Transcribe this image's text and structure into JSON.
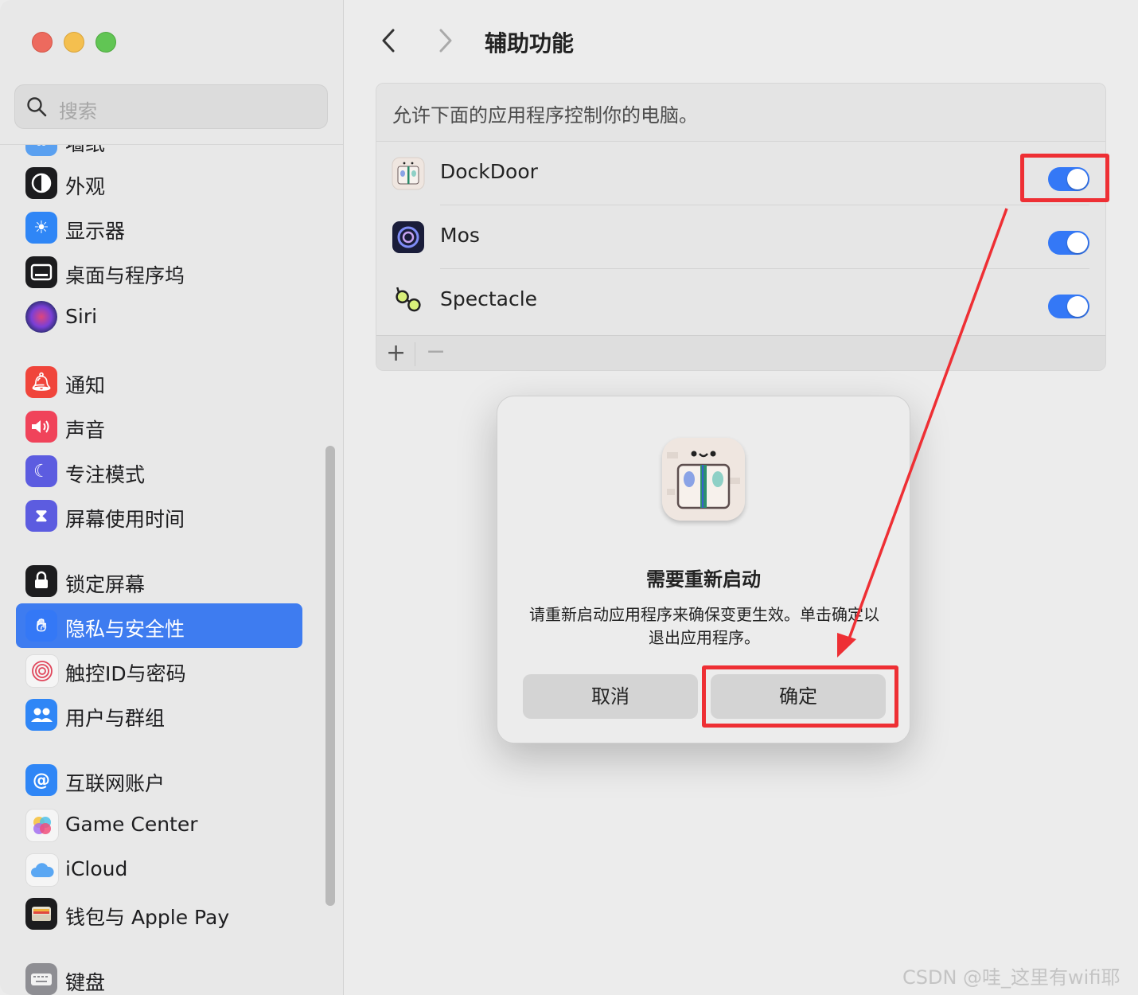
{
  "window": {
    "title": "辅助功能"
  },
  "search": {
    "placeholder": "搜索"
  },
  "sidebar": {
    "items": [
      {
        "label": "墙纸",
        "icon": "wallpaper-icon",
        "color": "#5aa0f0"
      },
      {
        "label": "外观",
        "icon": "appearance-icon",
        "color": "#1c1c1e"
      },
      {
        "label": "显示器",
        "icon": "display-icon",
        "color": "#2f86f6"
      },
      {
        "label": "桌面与程序坞",
        "icon": "dock-icon",
        "color": "#1c1c1e"
      },
      {
        "label": "Siri",
        "icon": "siri-icon",
        "color": "#3a2f6e"
      },
      {
        "label": "通知",
        "icon": "notification-bell-icon",
        "color": "#f0453b"
      },
      {
        "label": "声音",
        "icon": "speaker-icon",
        "color": "#f0435a"
      },
      {
        "label": "专注模式",
        "icon": "moon-icon",
        "color": "#5c5ce0"
      },
      {
        "label": "屏幕使用时间",
        "icon": "hourglass-icon",
        "color": "#5c5ce0"
      },
      {
        "label": "锁定屏幕",
        "icon": "lock-icon",
        "color": "#1c1c1e"
      },
      {
        "label": "隐私与安全性",
        "icon": "hand-icon",
        "color": "#3478f6"
      },
      {
        "label": "触控ID与密码",
        "icon": "fingerprint-icon",
        "color": "#f5f5f5"
      },
      {
        "label": "用户与群组",
        "icon": "users-icon",
        "color": "#2f86f6"
      },
      {
        "label": "互联网账户",
        "icon": "at-icon",
        "color": "#2f86f6"
      },
      {
        "label": "Game Center",
        "icon": "game-center-icon",
        "color": "#f5f5f5"
      },
      {
        "label": "iCloud",
        "icon": "cloud-icon",
        "color": "#f5f5f5"
      },
      {
        "label": "钱包与 Apple Pay",
        "icon": "wallet-icon",
        "color": "#1c1c1e"
      },
      {
        "label": "键盘",
        "icon": "keyboard-icon",
        "color": "#8e8e93"
      }
    ],
    "selected_index": 10
  },
  "header": {
    "title": "辅助功能"
  },
  "panel": {
    "description": "允许下面的应用程序控制你的电脑。",
    "apps": [
      {
        "name": "DockDoor",
        "enabled": true,
        "icon": "dockdoor-app-icon"
      },
      {
        "name": "Mos",
        "enabled": true,
        "icon": "mos-app-icon"
      },
      {
        "name": "Spectacle",
        "enabled": true,
        "icon": "spectacle-app-icon"
      }
    ],
    "add_label": "+",
    "remove_label": "−"
  },
  "dialog": {
    "title": "需要重新启动",
    "message": "请重新启动应用程序来确保变更生效。单击确定以退出应用程序。",
    "cancel_label": "取消",
    "ok_label": "确定",
    "icon": "dockdoor-app-icon"
  },
  "annotation": {
    "color": "#ee2f34"
  },
  "watermark": "CSDN @哇_这里有wifi耶"
}
